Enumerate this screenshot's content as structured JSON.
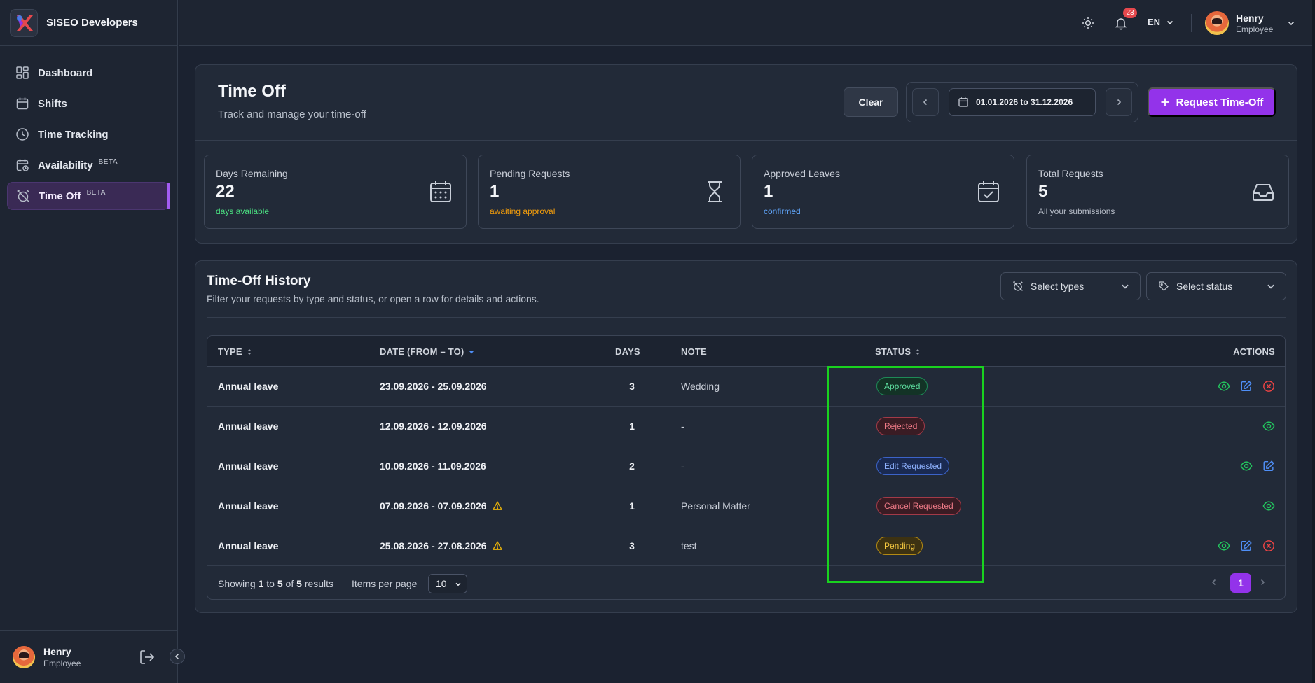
{
  "app": {
    "brand": "SISEO Developers"
  },
  "sidebar": {
    "items": [
      {
        "label": "Dashboard",
        "icon": "dashboard-icon"
      },
      {
        "label": "Shifts",
        "icon": "calendar-icon"
      },
      {
        "label": "Time Tracking",
        "icon": "clock-icon"
      },
      {
        "label": "Availability",
        "icon": "calendar-clock-icon",
        "badge": "BETA"
      },
      {
        "label": "Time Off",
        "icon": "alarm-off-icon",
        "badge": "BETA",
        "active": true
      }
    ],
    "user": {
      "name": "Henry",
      "role": "Employee"
    }
  },
  "topbar": {
    "notifications_count": "23",
    "language": "EN",
    "user": {
      "name": "Henry",
      "role": "Employee"
    }
  },
  "header": {
    "title": "Time Off",
    "subtitle": "Track and manage your time-off",
    "clear_label": "Clear",
    "date_range": "01.01.2026 to 31.12.2026",
    "request_label": "Request Time-Off"
  },
  "stats": [
    {
      "label": "Days Remaining",
      "value": "22",
      "note": "days available",
      "note_color": "#4ade80",
      "icon": "calendar-grid-icon"
    },
    {
      "label": "Pending Requests",
      "value": "1",
      "note": "awaiting approval",
      "note_color": "#f59e0b",
      "icon": "hourglass-icon"
    },
    {
      "label": "Approved Leaves",
      "value": "1",
      "note": "confirmed",
      "note_color": "#60a5fa",
      "icon": "calendar-check-icon"
    },
    {
      "label": "Total Requests",
      "value": "5",
      "note": "All your submissions",
      "note_color": "#b7bdc8",
      "icon": "inbox-icon"
    }
  ],
  "history": {
    "title": "Time-Off History",
    "subtitle": "Filter your requests by type and status, or open a row for details and actions.",
    "filter_types": "Select types",
    "filter_status": "Select status",
    "columns": {
      "type": "TYPE",
      "date": "DATE (FROM – TO)",
      "days": "DAYS",
      "note": "NOTE",
      "status": "STATUS",
      "actions": "ACTIONS"
    },
    "rows": [
      {
        "type": "Annual leave",
        "date": "23.09.2026 - 25.09.2026",
        "days": "3",
        "note": "Wedding",
        "status": "Approved",
        "status_color": "green",
        "warning": false,
        "actions": [
          "view",
          "edit",
          "cancel"
        ]
      },
      {
        "type": "Annual leave",
        "date": "12.09.2026 - 12.09.2026",
        "days": "1",
        "note": "-",
        "status": "Rejected",
        "status_color": "red",
        "warning": false,
        "actions": [
          "view"
        ]
      },
      {
        "type": "Annual leave",
        "date": "10.09.2026 - 11.09.2026",
        "days": "2",
        "note": "-",
        "status": "Edit Requested",
        "status_color": "blue",
        "warning": false,
        "actions": [
          "view",
          "edit"
        ]
      },
      {
        "type": "Annual leave",
        "date": "07.09.2026 - 07.09.2026",
        "days": "1",
        "note": "Personal Matter",
        "status": "Cancel Requested",
        "status_color": "red",
        "warning": true,
        "actions": [
          "view"
        ]
      },
      {
        "type": "Annual leave",
        "date": "25.08.2026 - 27.08.2026",
        "days": "3",
        "note": "test",
        "status": "Pending",
        "status_color": "yellow",
        "warning": true,
        "actions": [
          "view",
          "edit",
          "cancel"
        ]
      }
    ],
    "pagination": {
      "showing_prefix": "Showing",
      "from": "1",
      "to_word": "to",
      "to": "5",
      "of_word": "of",
      "total": "5",
      "suffix": "results",
      "items_per_page_label": "Items per page",
      "items_per_page": "10",
      "current_page": "1"
    }
  }
}
